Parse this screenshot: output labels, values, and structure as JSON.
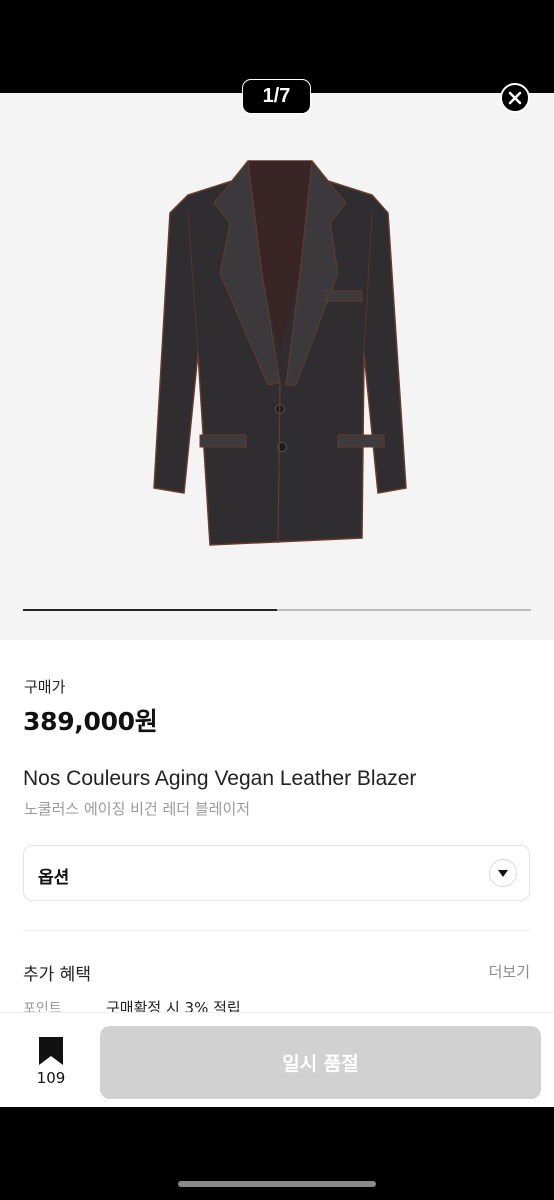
{
  "gallery": {
    "counter": "1/7",
    "progress_fraction": 0.5
  },
  "product": {
    "price_label": "구매가",
    "price": "389,000원",
    "name_en": "Nos Couleurs Aging Vegan Leather Blazer",
    "name_ko": "노쿨러스 에이징 비건 레더 블레이저"
  },
  "option": {
    "label": "옵션"
  },
  "benefits": {
    "title": "추가 혜택",
    "more": "더보기",
    "point_label": "포인트",
    "point_text": "구매확정 시 3% 적립"
  },
  "bottom": {
    "bookmark_count": "109",
    "cta_label": "일시 품절"
  },
  "icons": [
    "close-icon",
    "chevron-down-icon",
    "bookmark-icon"
  ],
  "colors": {
    "cta_disabled": "#d1d1d1",
    "gallery_bg": "#f4f4f4"
  }
}
